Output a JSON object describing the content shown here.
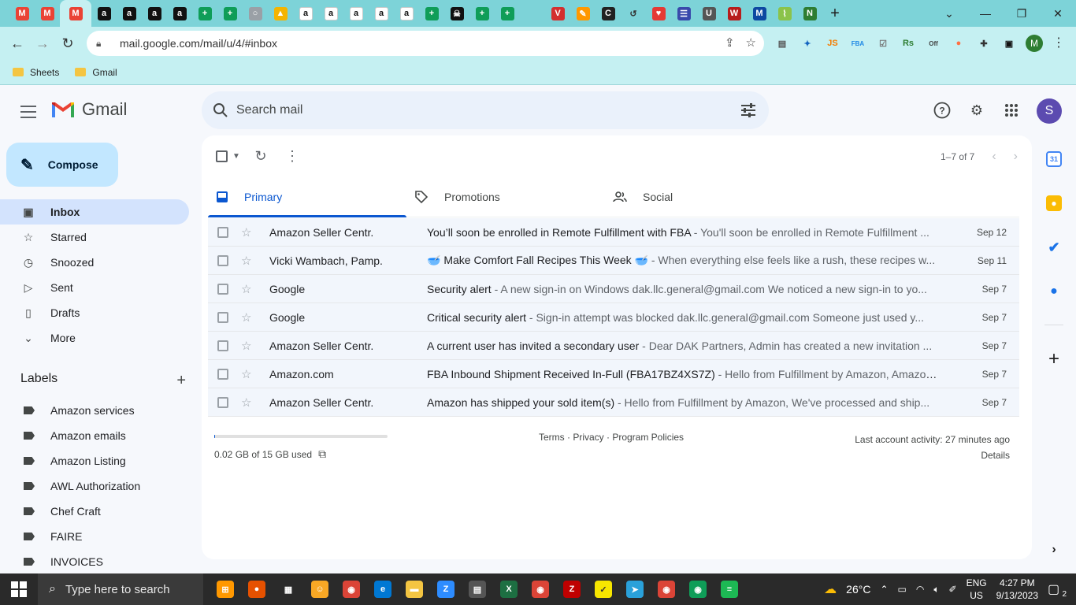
{
  "browser": {
    "tabs": [
      {
        "icon": "gmail-icon",
        "color": "#ea4335",
        "glyph": "M"
      },
      {
        "icon": "gmail-icon",
        "color": "#ea4335",
        "glyph": "M"
      },
      {
        "icon": "gmail-icon",
        "color": "#ea4335",
        "glyph": "M",
        "active": true
      },
      {
        "icon": "amazon-icon",
        "color": "#111111",
        "glyph": "a"
      },
      {
        "icon": "amazon-icon",
        "color": "#111111",
        "glyph": "a"
      },
      {
        "icon": "amazon-icon",
        "color": "#111111",
        "glyph": "a"
      },
      {
        "icon": "amazon-icon",
        "color": "#111111",
        "glyph": "a"
      },
      {
        "icon": "sheets-icon",
        "color": "#0f9d58",
        "glyph": "+"
      },
      {
        "icon": "sheets-icon",
        "color": "#0f9d58",
        "glyph": "+"
      },
      {
        "icon": "globe-icon",
        "color": "#9aa0a6",
        "glyph": "○"
      },
      {
        "icon": "drive-icon",
        "color": "#f4b400",
        "glyph": "▲"
      },
      {
        "icon": "amazon-smile-icon",
        "color": "#ffffff",
        "glyph": "a"
      },
      {
        "icon": "amazon-smile-icon",
        "color": "#ffffff",
        "glyph": "a"
      },
      {
        "icon": "amazon-smile-icon",
        "color": "#ffffff",
        "glyph": "a"
      },
      {
        "icon": "amazon-smile-icon",
        "color": "#ffffff",
        "glyph": "a"
      },
      {
        "icon": "amazon-smile-icon",
        "color": "#ffffff",
        "glyph": "a"
      },
      {
        "icon": "sheets-icon",
        "color": "#0f9d58",
        "glyph": "+"
      },
      {
        "icon": "pirate-icon",
        "color": "#111111",
        "glyph": "☠"
      },
      {
        "icon": "sheets-icon",
        "color": "#0f9d58",
        "glyph": "+"
      },
      {
        "icon": "sheets-icon",
        "color": "#0f9d58",
        "glyph": "+"
      },
      {
        "icon": "blank-icon",
        "color": "#7dd3d8",
        "glyph": ""
      },
      {
        "icon": "vivaldi-icon",
        "color": "#d32f2f",
        "glyph": "V"
      },
      {
        "icon": "pencil-colors-icon",
        "color": "#ff9800",
        "glyph": "✎"
      },
      {
        "icon": "circle-c-icon",
        "color": "#212121",
        "glyph": "C"
      },
      {
        "icon": "history-icon",
        "color": "#7dd3d8",
        "glyph": "↺"
      },
      {
        "icon": "heart-icon",
        "color": "#e53935",
        "glyph": "♥"
      },
      {
        "icon": "list-icon",
        "color": "#3949ab",
        "glyph": "☰"
      },
      {
        "icon": "uline-icon",
        "color": "#555555",
        "glyph": "U"
      },
      {
        "icon": "w-icon",
        "color": "#b71c1c",
        "glyph": "W"
      },
      {
        "icon": "m-icon",
        "color": "#0d47a1",
        "glyph": "M"
      },
      {
        "icon": "leaf-icon",
        "color": "#8bc34a",
        "glyph": "⌇"
      },
      {
        "icon": "n-icon",
        "color": "#2e7d32",
        "glyph": "N"
      }
    ],
    "new_tab_label": "+",
    "url": "mail.google.com/mail/u/4/#inbox",
    "bookmarks": [
      "Sheets",
      "Gmail"
    ],
    "extensions": [
      {
        "icon": "ext-screenshot-icon",
        "glyph": "▤",
        "color": "#555555"
      },
      {
        "icon": "ext-dice-icon",
        "glyph": "✦",
        "color": "#1565c0"
      },
      {
        "icon": "ext-js-icon",
        "glyph": "JS",
        "color": "#f57c00"
      },
      {
        "icon": "ext-fba-icon",
        "glyph": "FBA",
        "color": "#1e88e5"
      },
      {
        "icon": "ext-checklist-icon",
        "glyph": "☑",
        "color": "#757575"
      },
      {
        "icon": "ext-rs-icon",
        "glyph": "Rs",
        "color": "#2e7d32"
      },
      {
        "icon": "ext-off-icon",
        "glyph": "Off",
        "color": "#424242"
      },
      {
        "icon": "ext-orange-icon",
        "glyph": "●",
        "color": "#ff7043"
      },
      {
        "icon": "puzzle-icon",
        "glyph": "✚",
        "color": "#333333"
      },
      {
        "icon": "sidepanel-icon",
        "glyph": "▣",
        "color": "#111111"
      }
    ],
    "profile_initial": "M"
  },
  "gmail": {
    "logo_text": "Gmail",
    "search_placeholder": "Search mail",
    "avatar_initial": "S",
    "compose_label": "Compose",
    "nav": [
      {
        "label": "Inbox",
        "icon": "inbox-icon",
        "glyph": "▣",
        "active": true
      },
      {
        "label": "Starred",
        "icon": "star-icon",
        "glyph": "☆"
      },
      {
        "label": "Snoozed",
        "icon": "clock-icon",
        "glyph": "◷"
      },
      {
        "label": "Sent",
        "icon": "send-icon",
        "glyph": "▷"
      },
      {
        "label": "Drafts",
        "icon": "draft-icon",
        "glyph": "▯"
      },
      {
        "label": "More",
        "icon": "chevron-down-icon",
        "glyph": "⌄"
      }
    ],
    "labels_title": "Labels",
    "labels": [
      "Amazon services",
      "Amazon emails",
      "Amazon Listing",
      "AWL Authorization",
      "Chef Craft",
      "FAIRE",
      "INVOICES"
    ],
    "pagination": "1–7 of 7",
    "tabs": [
      {
        "label": "Primary",
        "icon": "inbox-tab-icon",
        "active": true
      },
      {
        "label": "Promotions",
        "icon": "tag-icon"
      },
      {
        "label": "Social",
        "icon": "people-icon"
      }
    ],
    "emails": [
      {
        "sender": "Amazon Seller Centr.",
        "subject": "You’ll soon be enrolled in Remote Fulfillment with FBA",
        "snippet": " - You'll soon be enrolled in Remote Fulfillment ...",
        "date": "Sep 12"
      },
      {
        "sender": "Vicki Wambach, Pamp.",
        "subject": "🥣 Make Comfort Fall Recipes This Week 🥣",
        "snippet": " - When everything else feels like a rush, these recipes w...",
        "date": "Sep 11"
      },
      {
        "sender": "Google",
        "subject": "Security alert",
        "snippet": " - A new sign-in on Windows dak.llc.general@gmail.com We noticed a new sign-in to yo...",
        "date": "Sep 7"
      },
      {
        "sender": "Google",
        "subject": "Critical security alert",
        "snippet": " - Sign-in attempt was blocked dak.llc.general@gmail.com Someone just used y...",
        "date": "Sep 7"
      },
      {
        "sender": "Amazon Seller Centr.",
        "subject": "A current user has invited a secondary user",
        "snippet": " - Dear DAK Partners, Admin has created a new invitation ...",
        "date": "Sep 7"
      },
      {
        "sender": "Amazon.com",
        "subject": "FBA Inbound Shipment Received In-Full (FBA17BZ4XS7Z)",
        "snippet": " - Hello from Fulfillment by Amazon, Amazon ...",
        "date": "Sep 7"
      },
      {
        "sender": "Amazon Seller Centr.",
        "subject": "Amazon has shipped your sold item(s)",
        "snippet": " - Hello from Fulfillment by Amazon, We've processed and ship...",
        "date": "Sep 7"
      }
    ],
    "storage_text": "0.02 GB of 15 GB used",
    "storage_fraction": 0.0013,
    "footer_links": "Terms · Privacy · Program Policies",
    "last_activity": "Last account activity: 27 minutes ago",
    "details_label": "Details"
  },
  "taskbar": {
    "search_placeholder": "Type here to search",
    "apps": [
      {
        "icon": "app-flowchart-icon",
        "glyph": "⊞",
        "color": "#ff9800"
      },
      {
        "icon": "app-basketball-icon",
        "glyph": "●",
        "color": "#e65100"
      },
      {
        "icon": "task-view-icon",
        "glyph": "▦",
        "color": "#2a2a2a"
      },
      {
        "icon": "app-character-icon",
        "glyph": "☺",
        "color": "#f9a825"
      },
      {
        "icon": "chrome-icon",
        "glyph": "◉",
        "color": "#db4437"
      },
      {
        "icon": "edge-icon",
        "glyph": "e",
        "color": "#0078d4"
      },
      {
        "icon": "file-explorer-icon",
        "glyph": "▬",
        "color": "#f4c542"
      },
      {
        "icon": "zoom-icon",
        "glyph": "Z",
        "color": "#2d8cff"
      },
      {
        "icon": "calculator-icon",
        "glyph": "▤",
        "color": "#555555"
      },
      {
        "icon": "excel-icon",
        "glyph": "X",
        "color": "#1d6f42"
      },
      {
        "icon": "chrome-profile-icon",
        "glyph": "◉",
        "color": "#db4437"
      },
      {
        "icon": "filezilla-icon",
        "glyph": "Z",
        "color": "#bf0000"
      },
      {
        "icon": "sticky-notes-icon",
        "glyph": "✓",
        "color": "#f7e600"
      },
      {
        "icon": "telegram-icon",
        "glyph": "➤",
        "color": "#2aa1da"
      },
      {
        "icon": "chrome-profile-icon",
        "glyph": "◉",
        "color": "#db4437"
      },
      {
        "icon": "chrome-profile-icon",
        "glyph": "◉",
        "color": "#0f9d58"
      },
      {
        "icon": "spotify-icon",
        "glyph": "≡",
        "color": "#1db954"
      }
    ],
    "weather": "26°C",
    "language_line1": "ENG",
    "language_line2": "US",
    "time": "4:27 PM",
    "date": "9/13/2023",
    "notifications": "2"
  }
}
